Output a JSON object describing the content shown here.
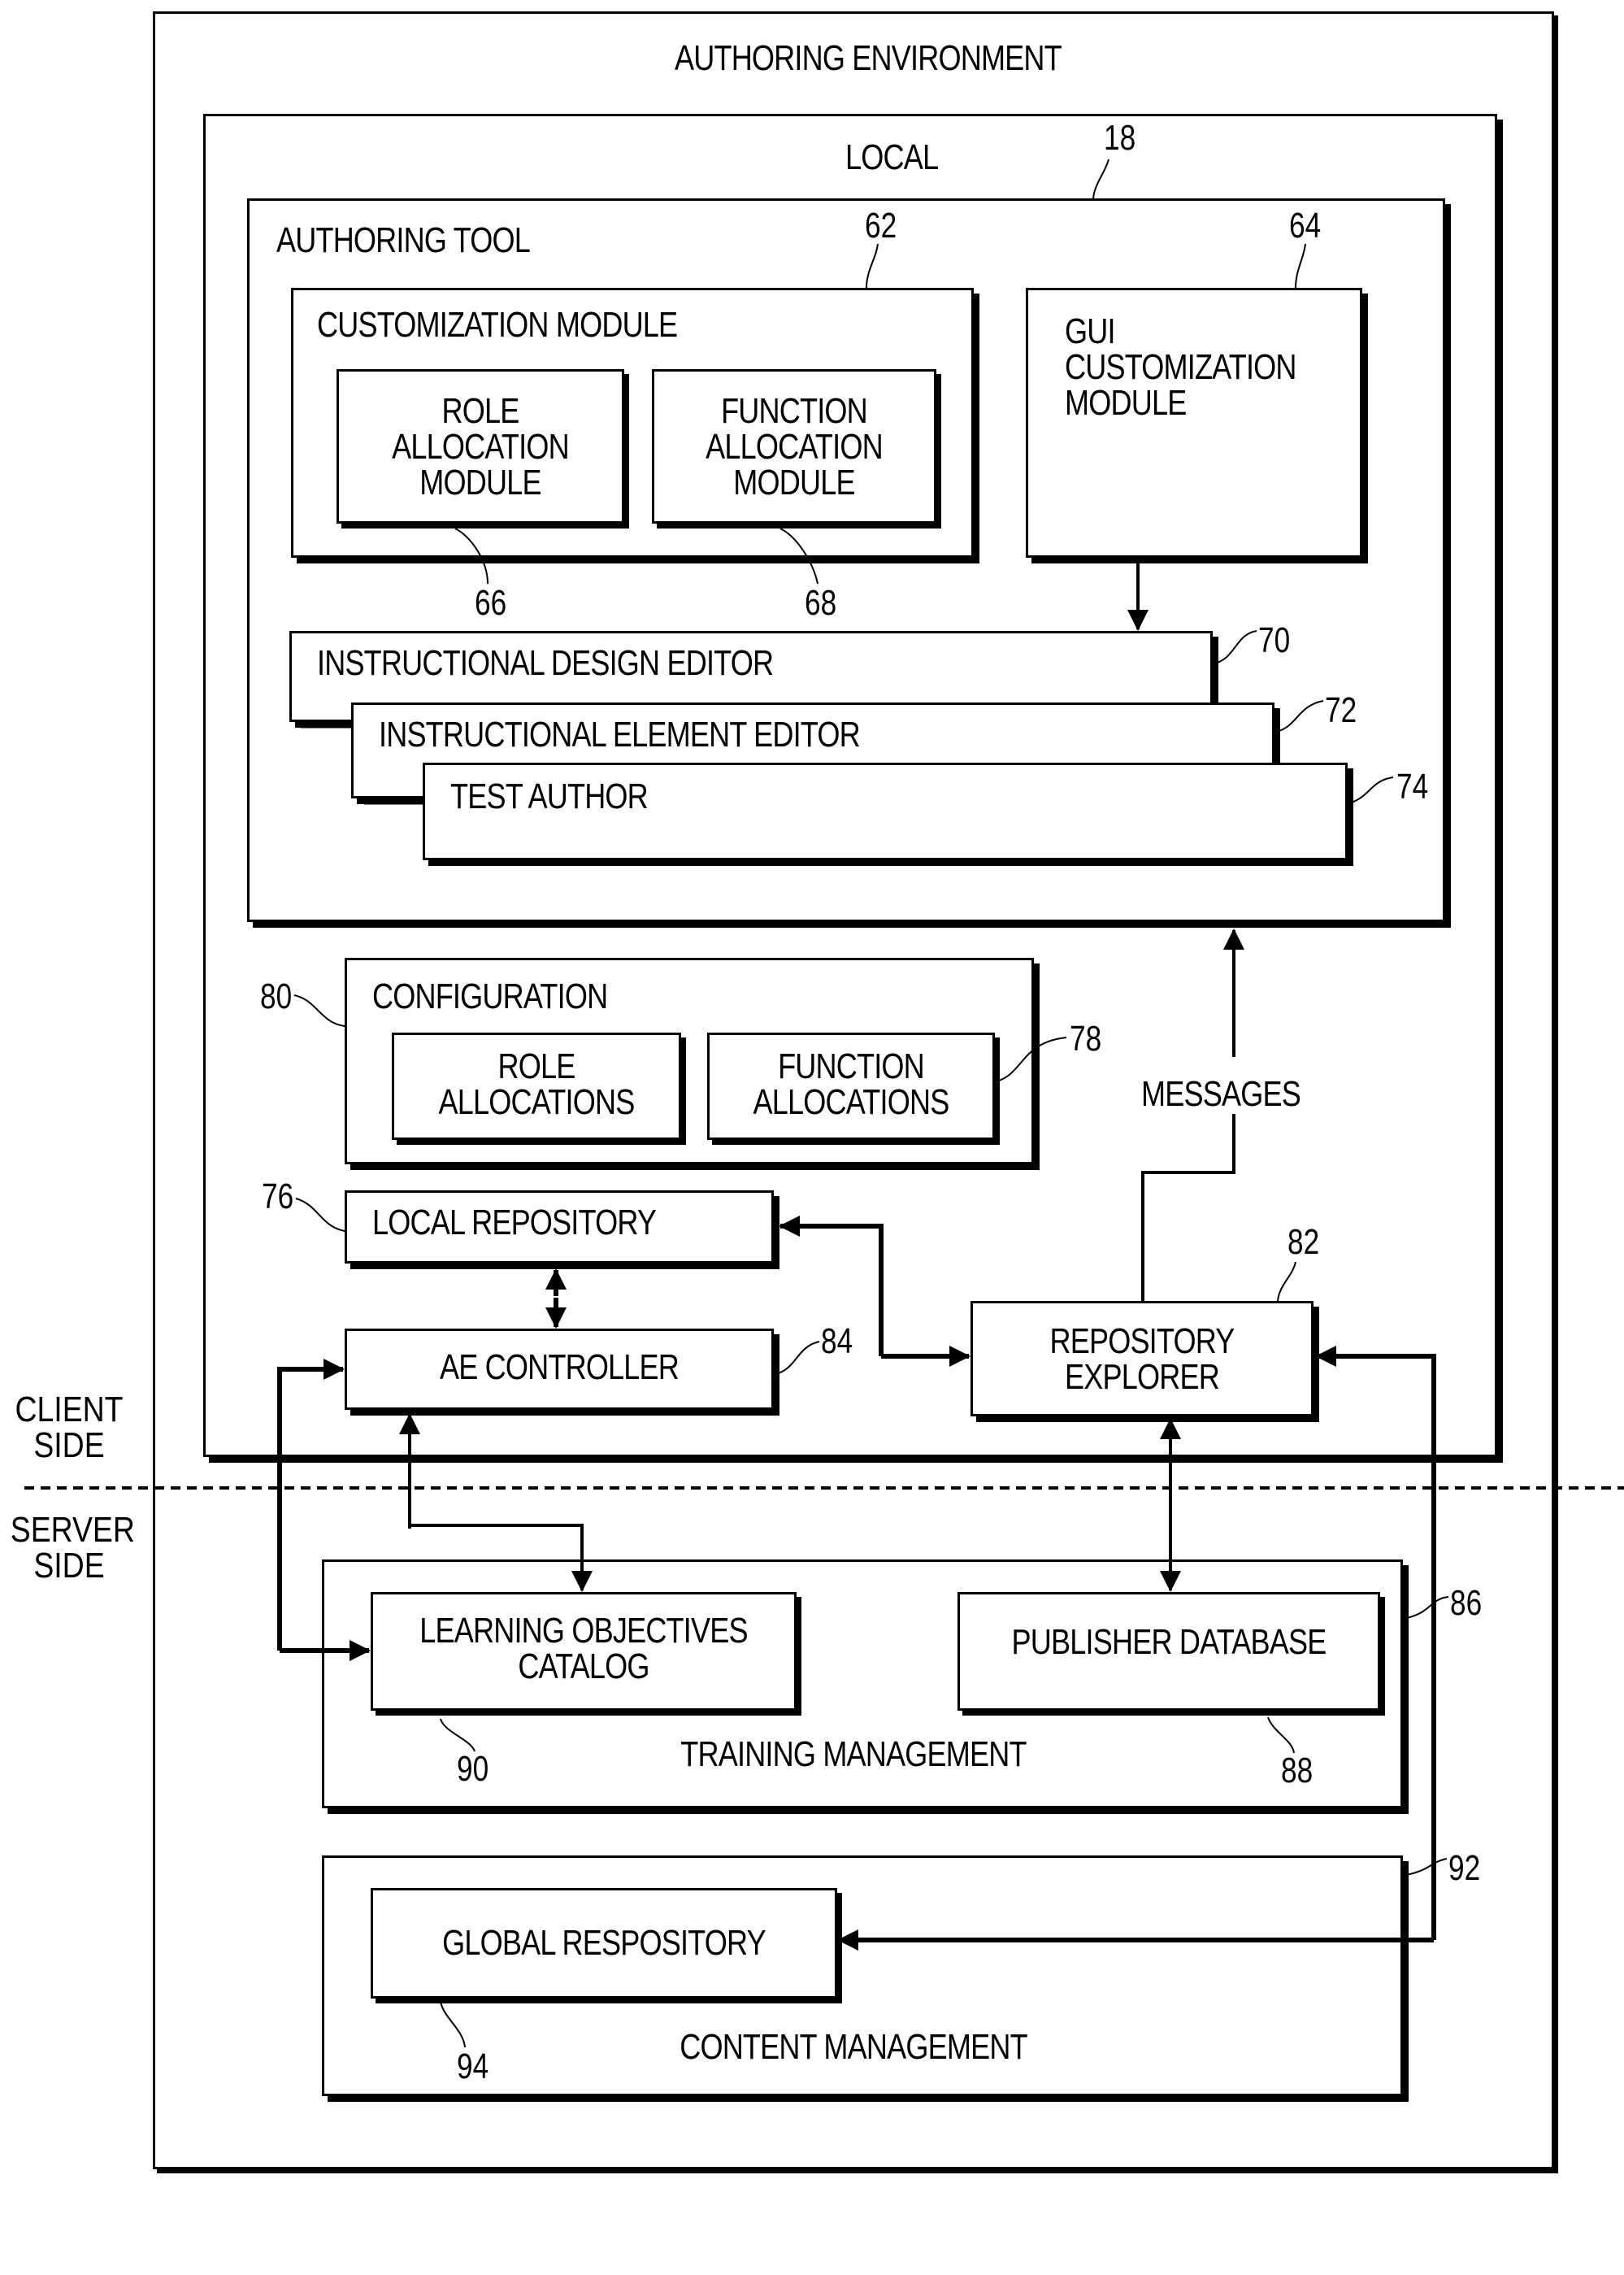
{
  "diagram": {
    "authoring_environment": "AUTHORING ENVIRONMENT",
    "local": "LOCAL",
    "ref_local": "18",
    "authoring_tool": "AUTHORING TOOL",
    "customization_module": {
      "label": "CUSTOMIZATION MODULE",
      "ref": "62"
    },
    "role_allocation_module": {
      "label": "ROLE\nALLOCATION\nMODULE",
      "ref": "66"
    },
    "function_allocation_module": {
      "label": "FUNCTION\nALLOCATION\nMODULE",
      "ref": "68"
    },
    "gui_customization_module": {
      "label": "GUI\nCUSTOMIZATION\nMODULE",
      "ref": "64"
    },
    "instructional_design_editor": {
      "label": "INSTRUCTIONAL DESIGN EDITOR",
      "ref": "70"
    },
    "instructional_element_editor": {
      "label": "INSTRUCTIONAL ELEMENT EDITOR",
      "ref": "72"
    },
    "test_author": {
      "label": "TEST AUTHOR",
      "ref": "74"
    },
    "configuration": {
      "label": "CONFIGURATION",
      "ref": "80"
    },
    "role_allocations": {
      "label": "ROLE\nALLOCATIONS"
    },
    "function_allocations": {
      "label": "FUNCTION\nALLOCATIONS",
      "ref": "78"
    },
    "messages": "MESSAGES",
    "local_repository": {
      "label": "LOCAL REPOSITORY",
      "ref": "76"
    },
    "ae_controller": {
      "label": "AE CONTROLLER",
      "ref": "84"
    },
    "repository_explorer": {
      "label": "REPOSITORY\nEXPLORER",
      "ref": "82"
    },
    "client_side": "CLIENT\nSIDE",
    "server_side": "SERVER\nSIDE",
    "training_management": {
      "label": "TRAINING MANAGEMENT",
      "ref": "86"
    },
    "learning_objectives_catalog": {
      "label": "LEARNING OBJECTIVES\nCATALOG",
      "ref": "90"
    },
    "publisher_database": {
      "label": "PUBLISHER DATABASE",
      "ref": "88"
    },
    "content_management": {
      "label": "CONTENT MANAGEMENT",
      "ref": "92"
    },
    "global_repository": {
      "label": "GLOBAL RESPOSITORY",
      "ref": "94"
    }
  }
}
